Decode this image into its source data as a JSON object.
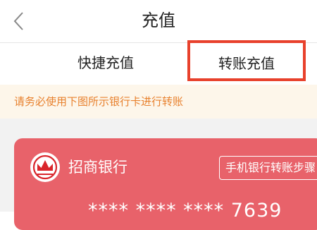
{
  "nav": {
    "title": "充值",
    "back_icon": "chevron-left-icon"
  },
  "tabs": [
    {
      "label": "快捷充值",
      "selected": false
    },
    {
      "label": "转账充值",
      "selected": true
    }
  ],
  "notice": {
    "text": "请务必使用下图所示银行卡进行转账"
  },
  "card": {
    "bank_name": "招商银行",
    "steps_button": "手机银行转账步骤",
    "card_number": "**** **** **** 7639",
    "color": "#e8626a",
    "logo_icon": "cmb-bank-logo-icon"
  },
  "colors": {
    "highlight": "#e8412c",
    "notice_text": "#e8812e",
    "notice_bg": "#fdf6ea"
  }
}
